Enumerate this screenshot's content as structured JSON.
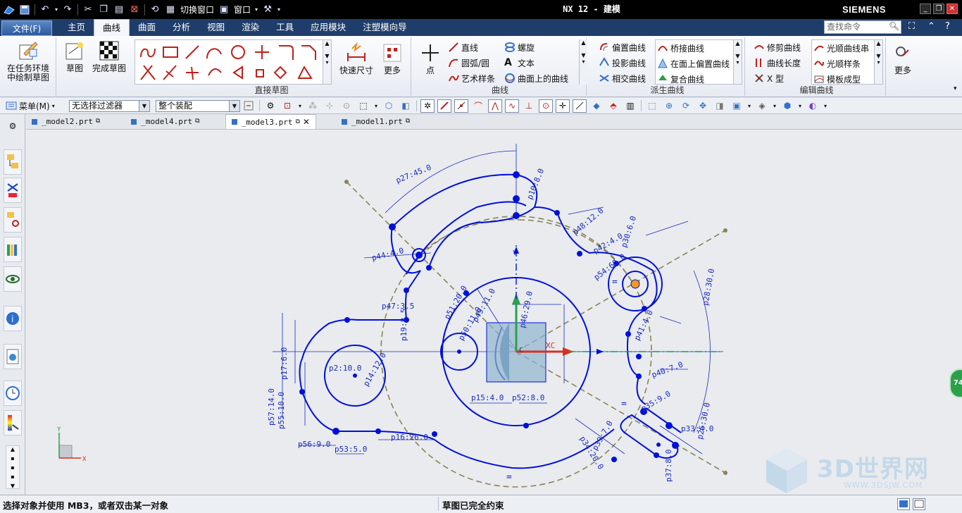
{
  "window": {
    "title": "NX 12 - 建模",
    "brand": "SIEMENS",
    "quick_access": {
      "switch_window": "切换窗口",
      "window_menu": "窗口"
    }
  },
  "search": {
    "placeholder": "查找命令"
  },
  "ribbon": {
    "file_label": "文件(F)",
    "tabs": [
      "主页",
      "曲线",
      "曲面",
      "分析",
      "视图",
      "渲染",
      "工具",
      "应用模块",
      "注塑模向导"
    ],
    "active_tab": "曲线",
    "groups": {
      "sketch_env": {
        "label_line1": "在任务环境",
        "label_line2": "中绘制草图"
      },
      "sketch": {
        "sketch_label": "草图",
        "finish_label": "完成草图"
      },
      "direct_sketch": {
        "label": "直接草图",
        "rapid_dim": "快速尺寸",
        "more": "更多"
      },
      "curve": {
        "label": "曲线",
        "point": "点",
        "line": "直线",
        "arc": "圆弧/圆",
        "art_spline": "艺术样条",
        "helix": "螺旋",
        "text": "文本",
        "curve_on_surface": "曲面上的曲线"
      },
      "derived": {
        "label": "派生曲线",
        "offset": "偏置曲线",
        "projected": "投影曲线",
        "intersect": "相交曲线",
        "bridge": "桥接曲线",
        "offset_in_face": "在面上偏置曲线",
        "composite": "复合曲线"
      },
      "edit": {
        "label": "编辑曲线",
        "trim": "修剪曲线",
        "length": "曲线长度",
        "x_form": "X 型",
        "smooth_string": "光顺曲线串",
        "smooth_spline": "光顺样条",
        "template": "模板成型"
      },
      "more": {
        "label": "更多"
      }
    }
  },
  "cmdbar": {
    "menu_label": "菜单(M)",
    "filter": "无选择过滤器",
    "scope": "整个装配"
  },
  "doc_tabs": [
    {
      "name": "_model2.prt",
      "active": false
    },
    {
      "name": "_model4.prt",
      "active": false
    },
    {
      "name": "_model3.prt",
      "active": true
    },
    {
      "name": "_model1.prt",
      "active": false
    }
  ],
  "sketch": {
    "dimensions": [
      "p27:45.0",
      "p10:8.0",
      "p48:12.0",
      "p42:4.0",
      "p30:6.0",
      "p44:4.0",
      "p54:60.0",
      "p28:30.0",
      "p47:3.5",
      "p51:20.0",
      "p50:11.0",
      "p49:11.0",
      "p46:29.0",
      "p19:8.5",
      "p41:4.0",
      "p17:6.0",
      "p14:12.0",
      "p2:10.0",
      "p40:7.0",
      "p57:14.0",
      "p55:10.0",
      "p15:4.0",
      "p52:8.0",
      "p35:9.0",
      "p56:9.0",
      "p53:5.0",
      "p16:26.0",
      "p34:20.0",
      "p39:7.0",
      "p33:4.0",
      "p25:30.0",
      "p37:8.0"
    ],
    "axis_labels": {
      "xc": "XC",
      "yc": "Y",
      "origin": "C"
    },
    "triad": {
      "x": "X",
      "y": "Y"
    }
  },
  "status": {
    "prompt": "选择对象并使用 MB3，或者双击某一对象",
    "message": "草图已完全约束"
  },
  "watermark": {
    "text": "3D世界网",
    "sub": "WWW.3DSJW.COM"
  },
  "badge": {
    "value": "74"
  },
  "colors": {
    "sketch_blue": "#0010d8",
    "dim_blue": "#1a2bbf",
    "ref_olive": "#8a8456",
    "ribbon_tab_bg": "#1f3d6b"
  }
}
